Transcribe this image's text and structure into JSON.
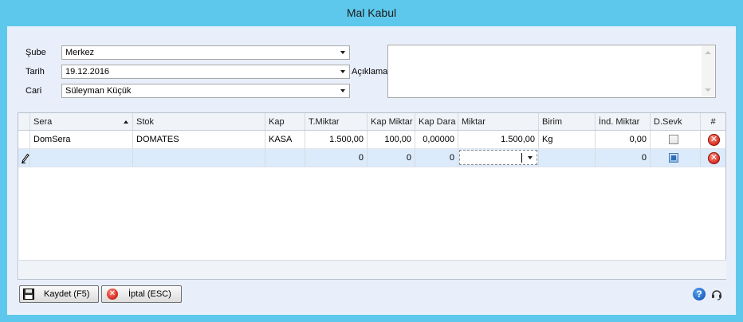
{
  "window": {
    "title": "Mal Kabul"
  },
  "form": {
    "sube_label": "Şube",
    "sube_value": "Merkez",
    "tarih_label": "Tarih",
    "tarih_value": "19.12.2016",
    "cari_label": "Cari",
    "cari_value": "Süleyman Küçük",
    "aciklama_label": "Açıklama"
  },
  "grid": {
    "columns": [
      "Sera",
      "Stok",
      "Kap",
      "T.Miktar",
      "Kap Miktar",
      "Kap Dara",
      "Miktar",
      "Birim",
      "İnd. Miktar",
      "D.Sevk",
      "#"
    ],
    "rows": [
      {
        "sera": "DomSera",
        "stok": "DOMATES",
        "kap": "KASA",
        "t_miktar": "1.500,00",
        "kap_miktar": "100,00",
        "kap_dara": "0,00000",
        "miktar": "1.500,00",
        "birim": "Kg",
        "ind_miktar": "0,00"
      },
      {
        "sera": "",
        "stok": "",
        "kap": "",
        "t_miktar": "0",
        "kap_miktar": "0",
        "kap_dara": "0",
        "miktar": "",
        "birim": "",
        "ind_miktar": "0"
      }
    ]
  },
  "buttons": {
    "save": "Kaydet (F5)",
    "cancel": "İptal (ESC)"
  },
  "icons": {
    "save": "floppy-disk-icon",
    "cancel": "cancel-icon",
    "help": "help-icon",
    "support": "headset-icon",
    "delete": "delete-row-icon",
    "edit": "pencil-icon"
  },
  "colors": {
    "title_bar": "#5ec8ec",
    "client_bg": "#e8effb",
    "selected_row": "#dcebfb",
    "delete_red": "#d3261a"
  }
}
